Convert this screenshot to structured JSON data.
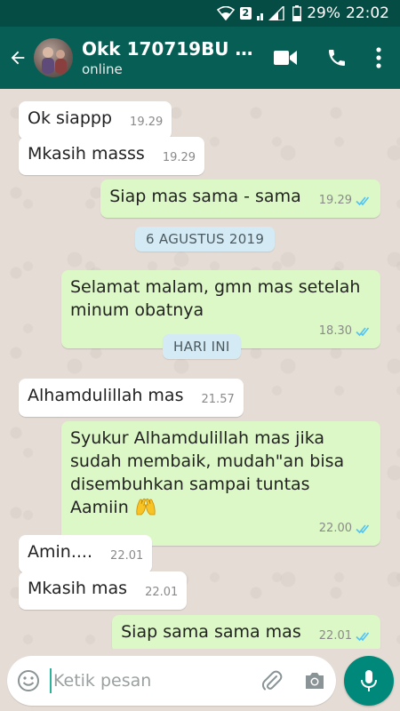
{
  "status_bar": {
    "sim": "2",
    "battery": "29%",
    "time": "22:02"
  },
  "header": {
    "name": "Okk 170719BU S...",
    "status": "online"
  },
  "messages": [
    {
      "dir": "in",
      "text": "Ok siappp",
      "time": "19.29"
    },
    {
      "dir": "in",
      "text": "Mkasih masss",
      "time": "19.29"
    },
    {
      "dir": "out",
      "text": "Siap mas sama - sama",
      "time": "19.29"
    },
    {
      "dir": "out",
      "text": "Selamat malam, gmn mas setelah minum obatnya",
      "time": "18.30"
    },
    {
      "dir": "in",
      "text": "Alhamdulillah mas",
      "time": "21.57"
    },
    {
      "dir": "out",
      "text": "Syukur Alhamdulillah mas jika sudah membaik, mudah\"an bisa disembuhkan sampai tuntas",
      "text2": "Aamiin",
      "time": "22.00"
    },
    {
      "dir": "in",
      "text": "Amin....",
      "time": "22.01"
    },
    {
      "dir": "in",
      "text": "Mkasih mas",
      "time": "22.01"
    },
    {
      "dir": "out",
      "text": "Siap sama sama mas",
      "time": "22.01"
    }
  ],
  "date_chips": [
    "6 AGUSTUS 2019",
    "HARI INI"
  ],
  "input": {
    "placeholder": "Ketik pesan",
    "value": ""
  },
  "colors": {
    "header": "#075e54",
    "status_bar": "#054d44",
    "outgoing": "#dcf8c6",
    "incoming": "#ffffff",
    "read_tick": "#4fc3f7",
    "mic": "#00897b"
  },
  "icons": [
    "back-arrow-icon",
    "video-call-icon",
    "phone-icon",
    "more-vert-icon",
    "emoji-icon",
    "attach-icon",
    "camera-icon",
    "mic-icon",
    "double-check-icon",
    "raising-hands-emoji"
  ]
}
